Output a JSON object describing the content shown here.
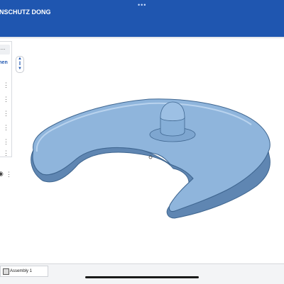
{
  "header": {
    "title": "NSCHUTZ DONG",
    "handle_glyph": "•••"
  },
  "panel": {
    "chip_text": "...",
    "label": "dnen"
  },
  "document_tabs": [
    {
      "label": "Assembly 1"
    }
  ],
  "colors": {
    "header": "#1f56b0",
    "part_fill": "#8fb5dc",
    "part_edge": "#3f6690"
  }
}
